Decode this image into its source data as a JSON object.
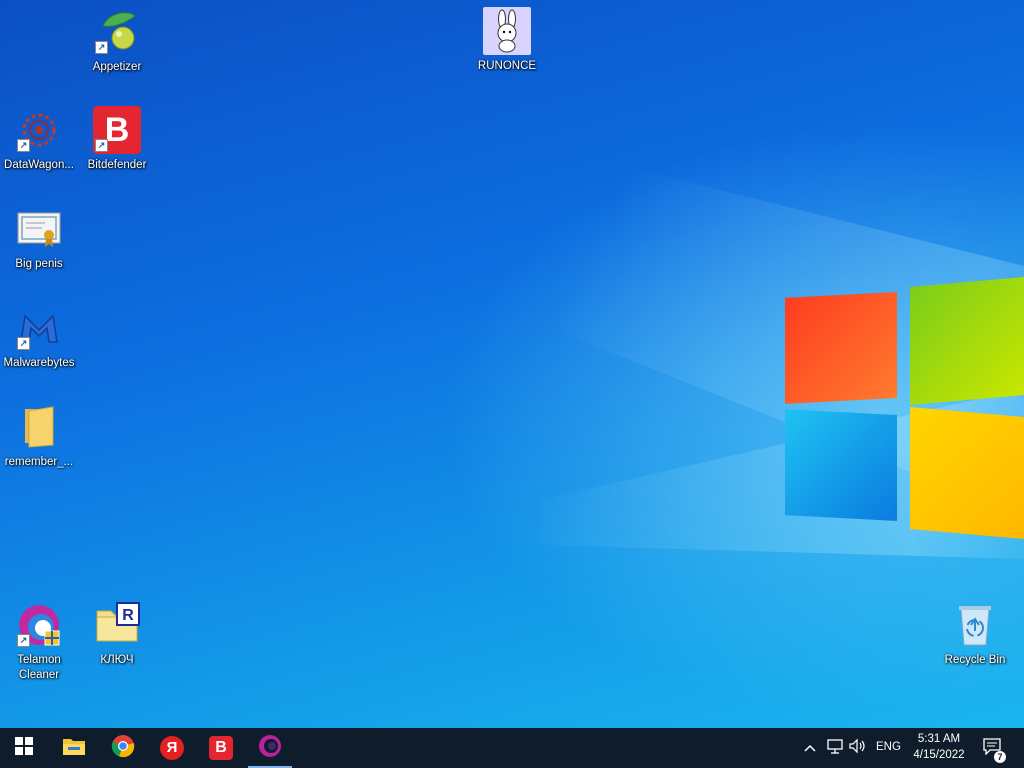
{
  "desktop_icons": {
    "appetizer": "Appetizer",
    "runonce": "RUNONCE",
    "datawagon": "DataWagon...",
    "bitdefender": "Bitdefender",
    "bigpenis": "Big penis",
    "malwarebytes": "Malwarebytes",
    "remember": "remember_...",
    "telamon": "Telamon Cleaner",
    "kluch": "КЛЮЧ",
    "recycle": "Recycle Bin"
  },
  "taskbar": {
    "pinned": [
      "start-icon",
      "file-explorer-icon",
      "chrome-icon",
      "yandex-browser-icon",
      "vivaldi-icon",
      "opera-icon"
    ],
    "yandex_glyph": "Я",
    "vivaldi_glyph": "B",
    "tray": {
      "language": "ENG",
      "time": "5:31 AM",
      "date": "4/15/2022",
      "notification_count": "7"
    }
  },
  "colors": {
    "taskbar_bg": "#0f1c2b",
    "accent": "#7eb4ea"
  }
}
